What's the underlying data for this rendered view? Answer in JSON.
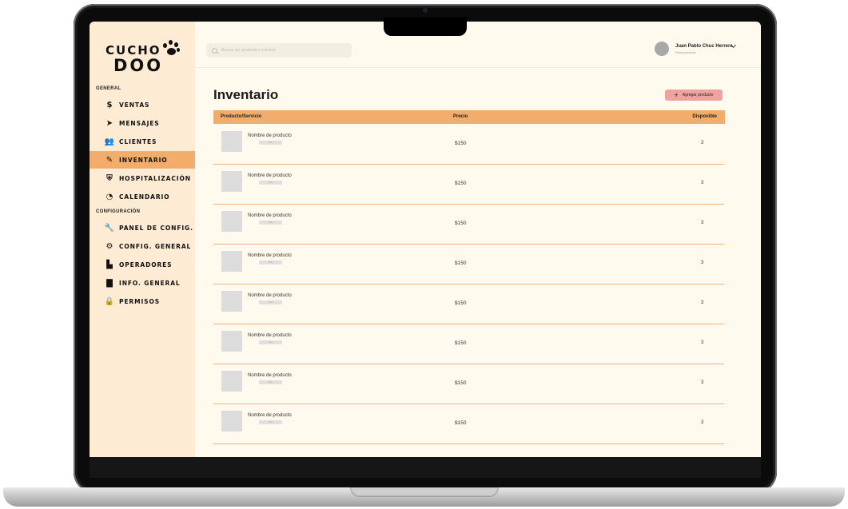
{
  "brand": {
    "line1": "CUCHO",
    "line2": "DOO"
  },
  "sidebar": {
    "sections": [
      {
        "label": "GENERAL",
        "items": [
          {
            "label": "VENTAS",
            "icon": "dollar-icon",
            "glyph": "$",
            "active": false
          },
          {
            "label": "MENSAJES",
            "icon": "send-icon",
            "glyph": "➤",
            "active": false
          },
          {
            "label": "CLIENTES",
            "icon": "users-icon",
            "glyph": "👥",
            "active": false
          },
          {
            "label": "INVENTARIO",
            "icon": "pencil-icon",
            "glyph": "✎",
            "active": true
          },
          {
            "label": "HOSPITALIZACIÓN",
            "icon": "shield-icon",
            "glyph": "⛨",
            "active": false
          },
          {
            "label": "CALENDARIO",
            "icon": "clock-icon",
            "glyph": "◔",
            "active": false
          }
        ]
      },
      {
        "label": "CONFIGURACIÓN",
        "items": [
          {
            "label": "PANEL DE CONFIG.",
            "icon": "wrench-icon",
            "glyph": "🔧",
            "active": false
          },
          {
            "label": "CONFIG. GENERAL",
            "icon": "gear-icon",
            "glyph": "⚙",
            "active": false
          },
          {
            "label": "OPERADORES",
            "icon": "briefcase-icon",
            "glyph": "▙",
            "active": false
          },
          {
            "label": "INFO. GENERAL",
            "icon": "document-icon",
            "glyph": "▇",
            "active": false
          },
          {
            "label": "PERMISOS",
            "icon": "lock-icon",
            "glyph": "🔒",
            "active": false
          }
        ]
      }
    ]
  },
  "header": {
    "search_placeholder": "Buscar por producto o servicio",
    "user_name": "Juan Pablo Chuc Herrera",
    "user_role": "Recepcionista"
  },
  "main": {
    "title": "Inventario",
    "add_button": "Agregar producto",
    "columns": [
      "Producto/Servicio",
      "Precio",
      "Disponible"
    ],
    "rows": [
      {
        "name": "Nombre de producto",
        "tag": "SKU",
        "price": "$150",
        "available": "3"
      },
      {
        "name": "Nombre de producto",
        "tag": "SKU",
        "price": "$150",
        "available": "3"
      },
      {
        "name": "Nombre de producto",
        "tag": "SKU",
        "price": "$150",
        "available": "3"
      },
      {
        "name": "Nombre de producto",
        "tag": "SKU",
        "price": "$150",
        "available": "3"
      },
      {
        "name": "Nombre de producto",
        "tag": "SKU",
        "price": "$150",
        "available": "3"
      },
      {
        "name": "Nombre de producto",
        "tag": "SKU",
        "price": "$150",
        "available": "3"
      },
      {
        "name": "Nombre de producto",
        "tag": "SKU",
        "price": "$150",
        "available": "3"
      },
      {
        "name": "Nombre de producto",
        "tag": "SKU",
        "price": "$150",
        "available": "3"
      }
    ]
  },
  "colors": {
    "accent": "#f2ad6a",
    "sidebar_bg": "#fdebd4",
    "content_bg": "#fffaed",
    "add_button_bg": "#efa3a0"
  }
}
